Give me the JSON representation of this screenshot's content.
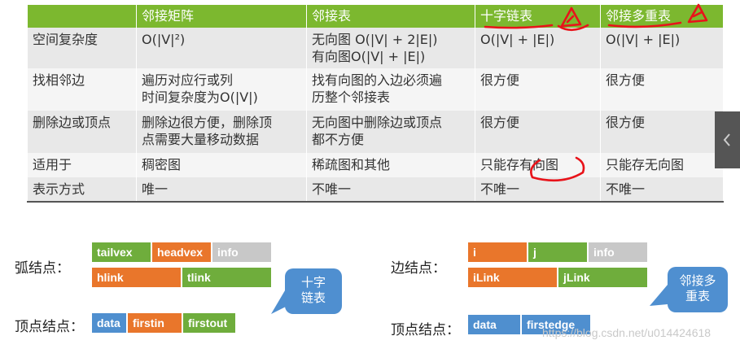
{
  "table": {
    "headers": [
      "",
      "邻接矩阵",
      "邻接表",
      "十字链表",
      "邻接多重表"
    ],
    "rows": [
      [
        "空间复杂度",
        "O(|V|²)",
        "无向图 O(|V| + 2|E|)\n有向图O(|V| + |E|)",
        "O(|V| + |E|)",
        "O(|V| + |E|)"
      ],
      [
        "找相邻边",
        "遍历对应行或列\n时间复杂度为O(|V|)",
        "找有向图的入边必须遍\n历整个邻接表",
        "很方便",
        "很方便"
      ],
      [
        "删除边或顶点",
        "删除边很方便，删除顶\n点需要大量移动数据",
        "无向图中删除边或顶点\n都不方便",
        "很方便",
        "很方便"
      ],
      [
        "适用于",
        "稠密图",
        "稀疏图和其他",
        "只能存有向图",
        "只能存无向图"
      ],
      [
        "表示方式",
        "唯一",
        "不唯一",
        "不唯一",
        "不唯一"
      ]
    ]
  },
  "left_diagram": {
    "arc_label": "弧结点：",
    "vertex_label": "顶点结点：",
    "arc_row1": [
      "tailvex",
      "headvex",
      "info"
    ],
    "arc_row2": [
      "hlink",
      "tlink"
    ],
    "vertex_row": [
      "data",
      "firstin",
      "firstout"
    ],
    "bubble": "十字\n链表"
  },
  "right_diagram": {
    "edge_label": "边结点：",
    "vertex_label": "顶点结点：",
    "edge_row1": [
      "i",
      "j",
      "info"
    ],
    "edge_row2": [
      "iLink",
      "jLink"
    ],
    "vertex_row": [
      "data",
      "firstedge"
    ],
    "bubble": "邻接多\n重表"
  },
  "watermark": "https://blog.csdn.net/u014424618",
  "colors": {
    "header_green": "#7cb82f",
    "node_green": "#6fad3c",
    "node_orange": "#e9762b",
    "node_gray": "#c8c8c8",
    "node_blue": "#4f8fcf",
    "annotation_red": "#e8131a"
  }
}
